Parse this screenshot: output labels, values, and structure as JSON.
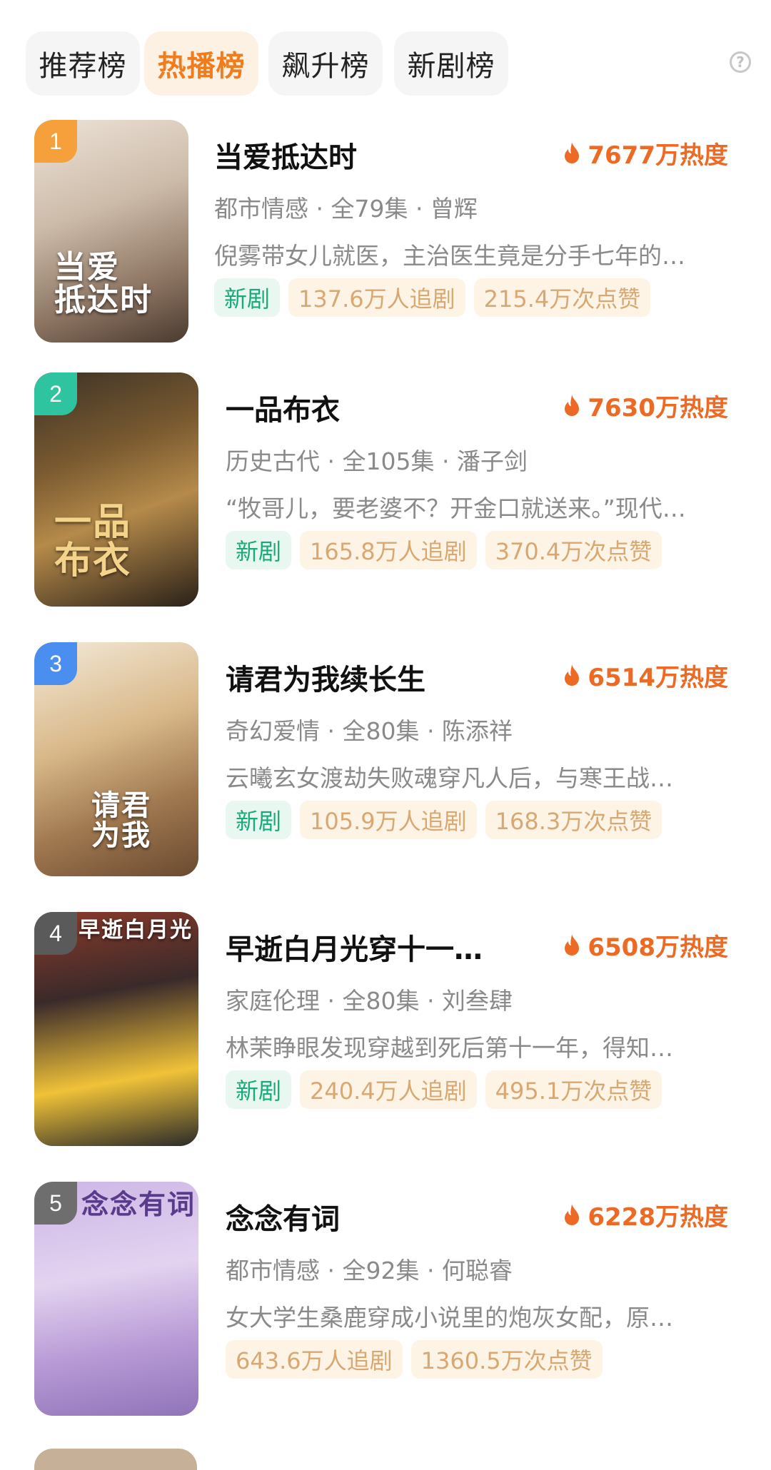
{
  "tabs": [
    {
      "label": "推荐榜",
      "active": false
    },
    {
      "label": "热播榜",
      "active": true
    },
    {
      "label": "飙升榜",
      "active": false
    },
    {
      "label": "新剧榜",
      "active": false
    }
  ],
  "help_icon": "question-circle-icon",
  "dramas": [
    {
      "rank": "1",
      "cover_text": "当爱\n抵达时",
      "title": "当爱抵达时",
      "heat": "7677万热度",
      "meta": "都市情感 · 全79集 · 曾辉",
      "desc": "倪雾带女儿就医，主治医生竟是分手七年的…",
      "tag_new": "新剧",
      "followers": "137.6万人追剧",
      "likes": "215.4万次点赞"
    },
    {
      "rank": "2",
      "cover_text": "一品\n布衣",
      "title": "一品布衣",
      "heat": "7630万热度",
      "meta": "历史古代 · 全105集 · 潘子剑",
      "desc": "“牧哥儿，要老婆不？开金口就送来。”现代…",
      "tag_new": "新剧",
      "followers": "165.8万人追剧",
      "likes": "370.4万次点赞"
    },
    {
      "rank": "3",
      "cover_text": "请君\n为我",
      "title": "请君为我续长生",
      "heat": "6514万热度",
      "meta": "奇幻爱情 · 全80集 · 陈添祥",
      "desc": "云曦玄女渡劫失败魂穿凡人后，与寒王战…",
      "tag_new": "新剧",
      "followers": "105.9万人追剧",
      "likes": "168.3万次点赞"
    },
    {
      "rank": "4",
      "cover_text": "早逝白月光",
      "title": "早逝白月光穿十一…",
      "heat": "6508万热度",
      "meta": "家庭伦理 · 全80集 · 刘叁肆",
      "desc": "林茉睁眼发现穿越到死后第十一年，得知…",
      "tag_new": "新剧",
      "followers": "240.4万人追剧",
      "likes": "495.1万次点赞"
    },
    {
      "rank": "5",
      "cover_text": "念念有词",
      "title": "念念有词",
      "heat": "6228万热度",
      "meta": "都市情感 · 全92集 · 何聪睿",
      "desc": "女大学生桑鹿穿成小说里的炮灰女配，原…",
      "tag_new": "",
      "followers": "643.6万人追剧",
      "likes": "1360.5万次点赞"
    }
  ],
  "colors": {
    "accent": "#ec6a24",
    "new_tag": "#1aa97a",
    "stat_tag": "#d9a872",
    "rank_colors": [
      "#f5a03a",
      "#2fc4a0",
      "#4a8ef0",
      "#5a5a5a",
      "#6e6e6e"
    ]
  }
}
